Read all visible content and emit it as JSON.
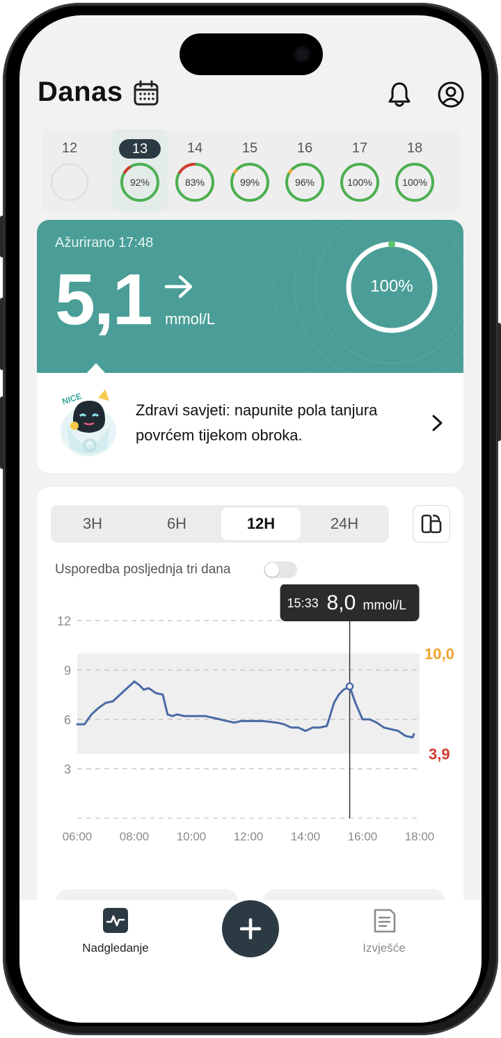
{
  "header": {
    "title": "Danas"
  },
  "dates": [
    {
      "day": "12",
      "percent": "",
      "empty": true
    },
    {
      "day": "13",
      "percent": "92%",
      "selected": true,
      "bad_fraction": 0.08,
      "bad_color": "#d03a2d"
    },
    {
      "day": "14",
      "percent": "83%",
      "bad_fraction": 0.17,
      "bad_color": "#d03a2d"
    },
    {
      "day": "15",
      "percent": "99%",
      "bad_fraction": 0.04,
      "bad_color": "#f0a32f"
    },
    {
      "day": "16",
      "percent": "96%",
      "bad_fraction": 0.04,
      "bad_color": "#f0a32f"
    },
    {
      "day": "17",
      "percent": "100%",
      "bad_fraction": 0
    },
    {
      "day": "18",
      "percent": "100%",
      "bad_fraction": 0
    }
  ],
  "glucose": {
    "updated": "Ažurirano 17:48",
    "value": "5,1",
    "unit": "mmol/L",
    "trend": "arrow-right-icon",
    "in_range": "100%"
  },
  "tip": {
    "text": "Zdravi savjeti: napunite pola tanjura povrćem tijekom obroka.",
    "badge": "NICE"
  },
  "chart_controls": {
    "ranges": [
      "3H",
      "6H",
      "12H",
      "24H"
    ],
    "active_range": "12H",
    "compare_label": "Usporedba posljednja tri dana",
    "compare_enabled": false
  },
  "tooltip": {
    "time": "15:33",
    "value": "8,0",
    "unit": "mmol/L"
  },
  "nav": {
    "monitor": "Nadgledanje",
    "report": "Izvješće"
  },
  "colors": {
    "teal": "#4a9e97",
    "dark": "#2c3a44",
    "green": "#4caf50",
    "high": "#f0a32f",
    "low": "#d03a2d",
    "line": "#4a6aa5"
  },
  "chart_data": {
    "type": "line",
    "x_unit": "time",
    "x_ticks": [
      "06:00",
      "08:00",
      "10:00",
      "12:00",
      "14:00",
      "16:00",
      "18:00"
    ],
    "y_ticks": [
      12,
      9,
      6,
      3
    ],
    "xlim": [
      "06:00",
      "18:00"
    ],
    "ylim": [
      0,
      12
    ],
    "target_range": {
      "low": "3,9",
      "high": "10,0",
      "low_value": 3.9,
      "high_value": 10.0
    },
    "series": [
      {
        "x": [
          "06:00",
          "06:15",
          "06:30",
          "06:45",
          "07:00",
          "07:15",
          "07:30",
          "07:45",
          "08:00",
          "08:10",
          "08:20",
          "08:30",
          "08:45",
          "09:00",
          "09:10",
          "09:20",
          "09:30",
          "09:45",
          "10:00",
          "10:30",
          "11:00",
          "11:15",
          "11:30",
          "11:45",
          "12:00",
          "12:30",
          "13:00",
          "13:15",
          "13:30",
          "13:45",
          "14:00",
          "14:15",
          "14:30",
          "14:45",
          "15:00",
          "15:10",
          "15:20",
          "15:33",
          "15:45",
          "16:00",
          "16:15",
          "16:30",
          "16:45",
          "17:00",
          "17:15",
          "17:30",
          "17:45",
          "17:48"
        ],
        "y": [
          5.7,
          5.7,
          6.3,
          6.7,
          7.0,
          7.1,
          7.5,
          7.9,
          8.3,
          8.1,
          7.8,
          7.9,
          7.6,
          7.5,
          6.3,
          6.2,
          6.3,
          6.2,
          6.2,
          6.2,
          6.0,
          5.9,
          5.8,
          5.9,
          5.9,
          5.9,
          5.8,
          5.7,
          5.5,
          5.5,
          5.3,
          5.5,
          5.5,
          5.6,
          7.0,
          7.5,
          7.8,
          8.0,
          7.0,
          6.0,
          6.0,
          5.8,
          5.5,
          5.4,
          5.3,
          5.0,
          4.9,
          5.1
        ]
      }
    ]
  }
}
